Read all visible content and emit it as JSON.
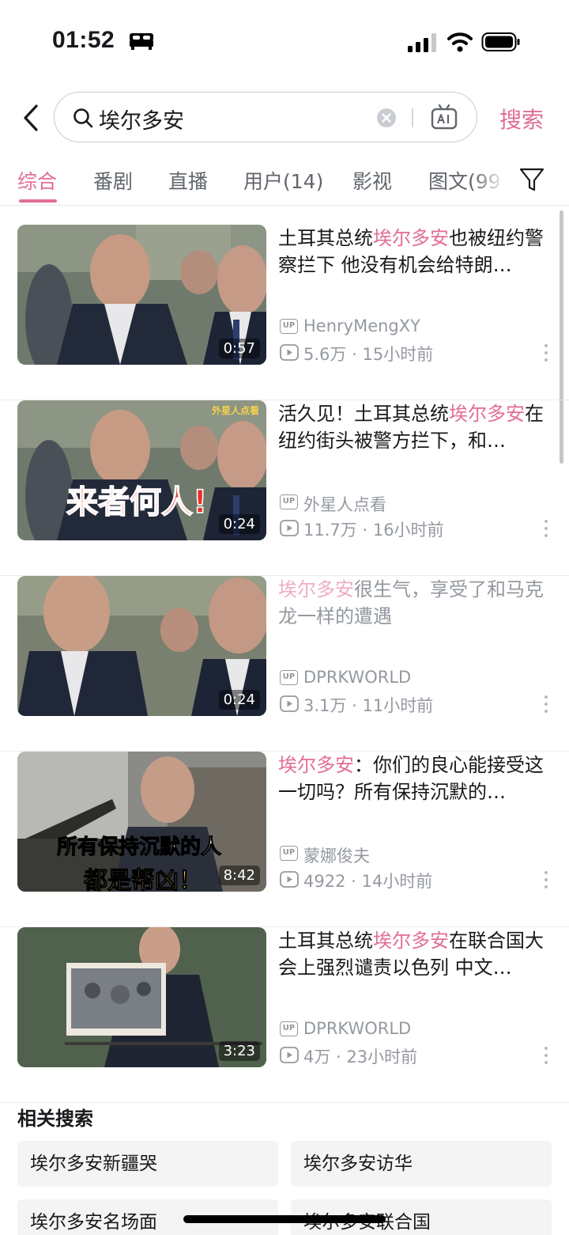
{
  "status_bar": {
    "time": "01:52"
  },
  "search": {
    "query": "埃尔多安",
    "submit_label": "搜索"
  },
  "tabs": [
    {
      "label": "综合",
      "active": true
    },
    {
      "label": "番剧"
    },
    {
      "label": "直播"
    },
    {
      "label": "用户(14)"
    },
    {
      "label": "影视"
    },
    {
      "label": "图文(99"
    }
  ],
  "videos": [
    {
      "title_pre": "土耳其总统",
      "title_hl": "埃尔多安",
      "title_post": "也被纽约警察拦下 他没有机会给特朗…",
      "duration": "0:57",
      "author": "HenryMengXY",
      "views": "5.6万",
      "time_ago": "15小时前",
      "up_badge": "UP",
      "sep": "·"
    },
    {
      "title_pre": "活久见！土耳其总统",
      "title_hl": "埃尔多安",
      "title_post": "在纽约街头被警方拦下，和…",
      "duration": "0:24",
      "author": "外星人点看",
      "views": "11.7万",
      "time_ago": "16小时前",
      "thumb_caption": "来者何人!",
      "thumb_corner": "外星人点看",
      "up_badge": "UP",
      "sep": "·"
    },
    {
      "title_pre": "",
      "title_hl": "埃尔多安",
      "title_post": "很生气，享受了和马克龙一样的遭遇",
      "duration": "0:24",
      "author": "DPRKWORLD",
      "views": "3.1万",
      "time_ago": "11小时前",
      "visited": true,
      "up_badge": "UP",
      "sep": "·"
    },
    {
      "title_pre": "",
      "title_hl": "埃尔多安",
      "title_post": "：你们的良心能接受这一切吗？所有保持沉默的…",
      "duration": "8:42",
      "author": "蒙娜俊夫",
      "views": "4922",
      "time_ago": "14小时前",
      "thumb_caption_1": "所有保持沉默的人",
      "thumb_caption_2": "都是帮凶！",
      "up_badge": "UP",
      "sep": "·"
    },
    {
      "title_pre": "土耳其总统",
      "title_hl": "埃尔多安",
      "title_post": "在联合国大会上强烈谴责以色列 中文…",
      "duration": "3:23",
      "author": "DPRKWORLD",
      "views": "4万",
      "time_ago": "23小时前",
      "up_badge": "UP",
      "sep": "·"
    }
  ],
  "related": {
    "title": "相关搜索",
    "items": [
      "埃尔多安新疆哭",
      "埃尔多安访华",
      "埃尔多安名场面",
      "埃尔多安联合国"
    ]
  },
  "colors": {
    "accent": "#e26d95",
    "text": "#18191c",
    "muted": "#9499a0"
  },
  "icons": [
    "bed-icon",
    "signal-icon",
    "wifi-icon",
    "battery-icon",
    "back-icon",
    "search-icon",
    "clear-icon",
    "ai-icon",
    "filter-icon",
    "up-badge-icon",
    "play-count-icon",
    "more-icon"
  ]
}
